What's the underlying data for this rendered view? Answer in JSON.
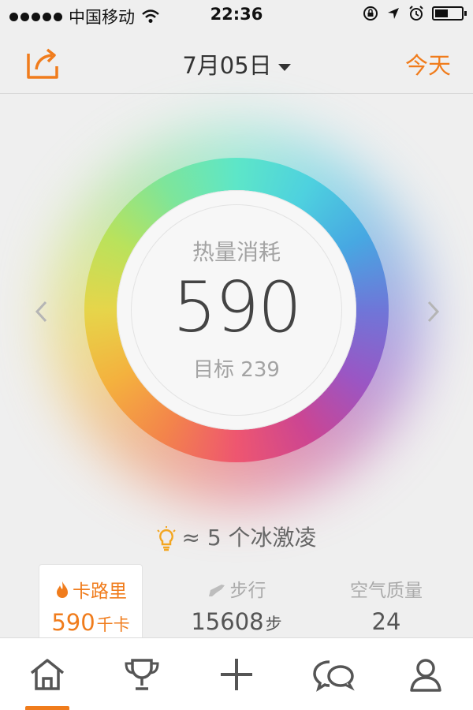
{
  "status_bar": {
    "carrier": "中国移动",
    "time": "22:36"
  },
  "nav": {
    "date": "7月05日",
    "today_label": "今天"
  },
  "ring": {
    "label": "热量消耗",
    "value": "590",
    "goal_text": "目标 239"
  },
  "tip": {
    "text": "≈ 5 个冰激凌"
  },
  "stats": [
    {
      "name": "卡路里",
      "value": "590",
      "unit": "千卡",
      "icon": "flame-icon",
      "active": true
    },
    {
      "name": "步行",
      "value": "15608",
      "unit": "步",
      "icon": "shoe-icon",
      "active": false
    },
    {
      "name": "空气质量",
      "value": "24",
      "unit": "",
      "active": false
    }
  ],
  "tabs": [
    {
      "name": "home",
      "icon": "home-icon",
      "active": true
    },
    {
      "name": "trophy",
      "icon": "trophy-icon",
      "active": false
    },
    {
      "name": "add",
      "icon": "plus-icon",
      "active": false
    },
    {
      "name": "chat",
      "icon": "chat-icon",
      "active": false
    },
    {
      "name": "profile",
      "icon": "user-icon",
      "active": false
    }
  ],
  "colors": {
    "accent": "#f07c1c",
    "background": "#efefef",
    "text_dark": "#444444",
    "text_muted": "#a3a3a3"
  }
}
